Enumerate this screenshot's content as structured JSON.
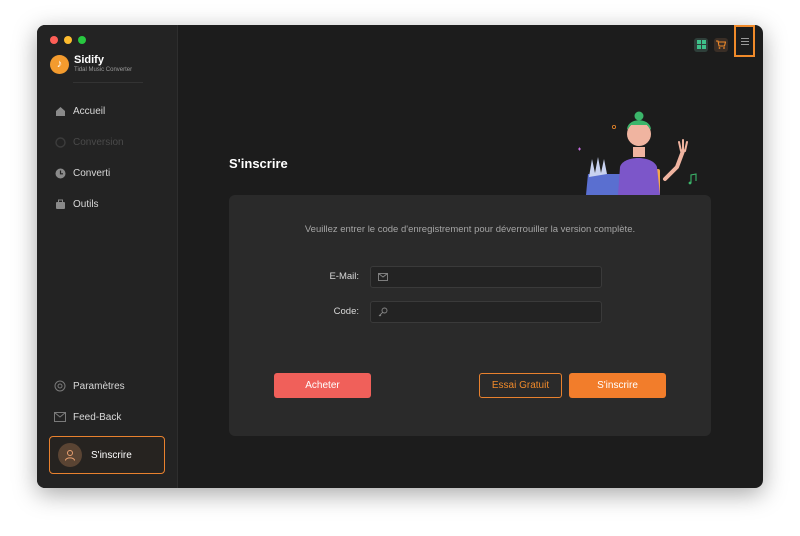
{
  "app": {
    "name": "Sidify",
    "subtitle": "Tidal Music Converter"
  },
  "sidebar": {
    "items": [
      {
        "label": "Accueil",
        "icon": "home-icon",
        "enabled": true
      },
      {
        "label": "Conversion",
        "icon": "conversion-icon",
        "enabled": false
      },
      {
        "label": "Converti",
        "icon": "clock-icon",
        "enabled": true
      },
      {
        "label": "Outils",
        "icon": "toolbox-icon",
        "enabled": true
      }
    ],
    "settings_label": "Paramètres",
    "feedback_label": "Feed-Back",
    "signup_label": "S'inscrire"
  },
  "page": {
    "title": "S'inscrire",
    "info": "Veuillez entrer le code d'enregistrement pour déverrouiller la version complète.",
    "email_label": "E-Mail:",
    "email_value": "",
    "code_label": "Code:",
    "code_value": "",
    "buy_label": "Acheter",
    "trial_label": "Essai Gratuit",
    "signup_label": "S'inscrire"
  },
  "colors": {
    "accent": "#f27d2b",
    "buy": "#f0605a",
    "background": "#1c1c1c"
  }
}
